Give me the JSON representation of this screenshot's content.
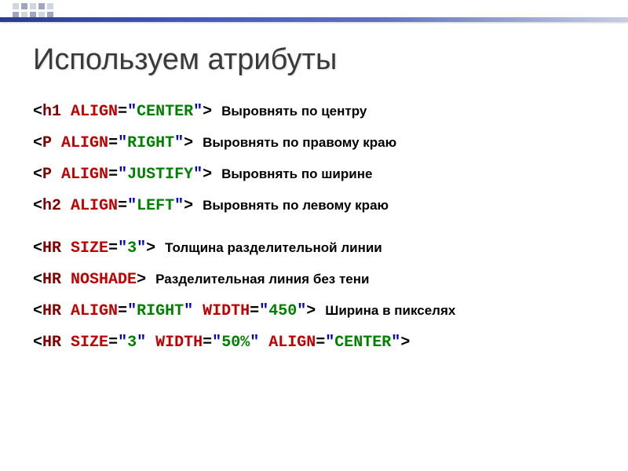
{
  "title": "Используем атрибуты",
  "lines": [
    {
      "tag": "h1",
      "attrs": [
        {
          "name": "ALIGN",
          "value": "CENTER"
        }
      ],
      "desc": "Выровнять по центру"
    },
    {
      "tag": "P",
      "attrs": [
        {
          "name": "ALIGN",
          "value": "RIGHT"
        }
      ],
      "desc": "Выровнять по правому краю"
    },
    {
      "tag": "P",
      "attrs": [
        {
          "name": "ALIGN",
          "value": "JUSTIFY"
        }
      ],
      "desc": "Выровнять по ширине"
    },
    {
      "tag": "h2",
      "attrs": [
        {
          "name": "ALIGN",
          "value": "LEFT"
        }
      ],
      "desc": "Выровнять по левому краю"
    },
    {
      "spacer": true
    },
    {
      "tag": "HR",
      "attrs": [
        {
          "name": "SIZE",
          "value": "3"
        }
      ],
      "desc": "Толщина разделительной линии"
    },
    {
      "tag": "HR",
      "attrs": [
        {
          "name": "NOSHADE",
          "novalue": true
        }
      ],
      "desc": "Разделительная линия без тени"
    },
    {
      "tag": "HR",
      "attrs": [
        {
          "name": "ALIGN",
          "value": "RIGHT"
        },
        {
          "name": "WIDTH",
          "value": "450"
        }
      ],
      "desc": "Ширина в пикселях"
    },
    {
      "tag": "HR",
      "attrs": [
        {
          "name": "SIZE",
          "value": "3"
        },
        {
          "name": "WIDTH",
          "value": "50%"
        },
        {
          "name": "ALIGN",
          "value": "CENTER"
        }
      ],
      "desc": ""
    }
  ]
}
